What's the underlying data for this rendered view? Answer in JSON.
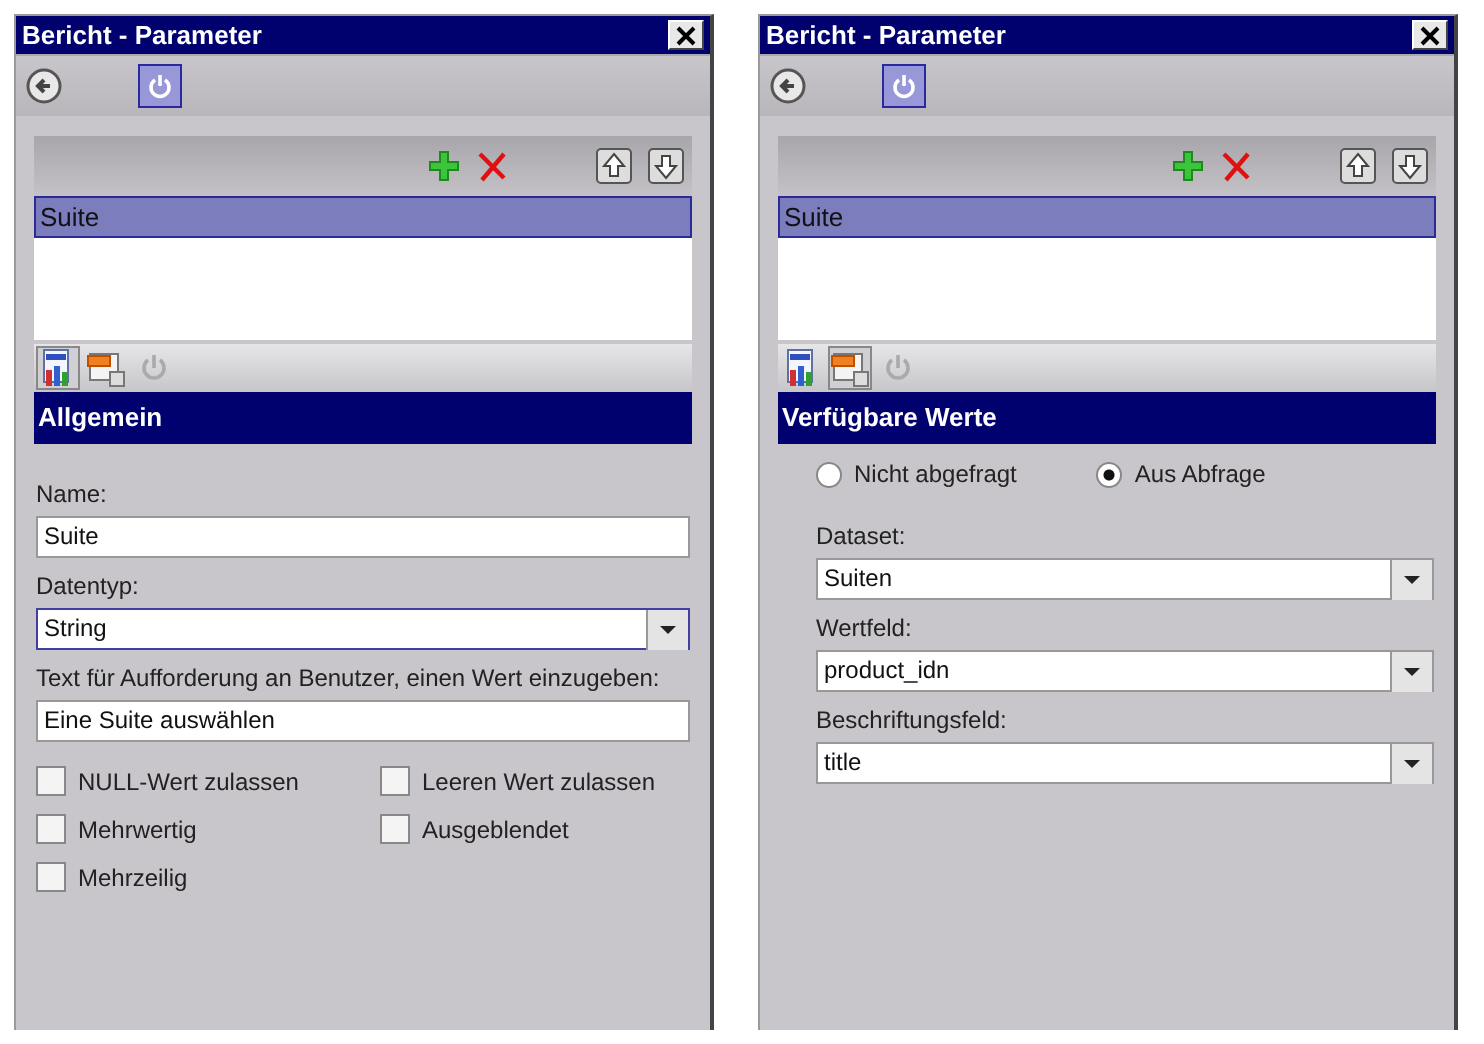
{
  "panels": [
    {
      "title": "Bericht - Parameter",
      "parameters": [
        {
          "name": "Suite",
          "selected": true
        }
      ],
      "tabs": [
        {
          "kind": "report",
          "selected": true
        },
        {
          "kind": "form",
          "selected": false
        },
        {
          "kind": "power",
          "selected": false
        }
      ],
      "section": {
        "kind": "general",
        "title": "Allgemein",
        "fields": [
          {
            "kind": "text",
            "label": "Name:",
            "value": "Suite",
            "focused": false
          },
          {
            "kind": "select",
            "label": "Datentyp:",
            "value": "String",
            "focused": true
          },
          {
            "kind": "text",
            "label": "Text für Aufforderung an Benutzer, einen Wert einzugeben:",
            "value": "Eine Suite auswählen",
            "focused": false
          }
        ],
        "checkboxes": [
          {
            "label": "NULL-Wert zulassen",
            "checked": false
          },
          {
            "label": "Leeren Wert zulassen",
            "checked": false
          },
          {
            "label": "Mehrwertig",
            "checked": false
          },
          {
            "label": "Ausgeblendet",
            "checked": false
          },
          {
            "label": "Mehrzeilig",
            "checked": false
          }
        ]
      }
    },
    {
      "title": "Bericht - Parameter",
      "parameters": [
        {
          "name": "Suite",
          "selected": true
        }
      ],
      "tabs": [
        {
          "kind": "report",
          "selected": false
        },
        {
          "kind": "form",
          "selected": true
        },
        {
          "kind": "power",
          "selected": false
        }
      ],
      "section": {
        "kind": "values",
        "title": "Verfügbare Werte",
        "radios": [
          {
            "label": "Nicht abgefragt",
            "selected": false
          },
          {
            "label": "Aus Abfrage",
            "selected": true
          }
        ],
        "fields": [
          {
            "kind": "select",
            "label": "Dataset:",
            "value": "Suiten",
            "focused": false
          },
          {
            "kind": "select",
            "label": "Wertfeld:",
            "value": "product_idn",
            "focused": false
          },
          {
            "kind": "select",
            "label": "Beschriftungsfeld:",
            "value": "title",
            "focused": false
          }
        ]
      }
    }
  ]
}
